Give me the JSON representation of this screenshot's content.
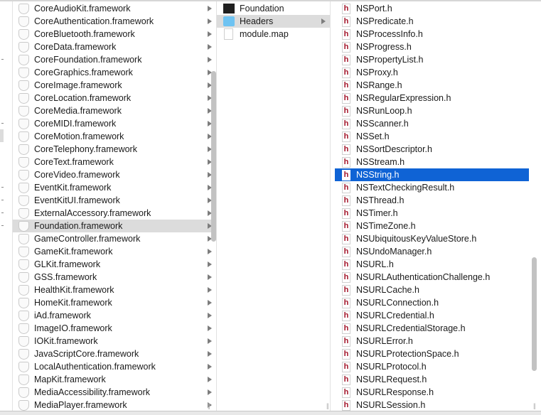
{
  "column1": {
    "items": [
      "CoreAudioKit.framework",
      "CoreAuthentication.framework",
      "CoreBluetooth.framework",
      "CoreData.framework",
      "CoreFoundation.framework",
      "CoreGraphics.framework",
      "CoreImage.framework",
      "CoreLocation.framework",
      "CoreMedia.framework",
      "CoreMIDI.framework",
      "CoreMotion.framework",
      "CoreTelephony.framework",
      "CoreText.framework",
      "CoreVideo.framework",
      "EventKit.framework",
      "EventKitUI.framework",
      "ExternalAccessory.framework",
      "Foundation.framework",
      "GameController.framework",
      "GameKit.framework",
      "GLKit.framework",
      "GSS.framework",
      "HealthKit.framework",
      "HomeKit.framework",
      "iAd.framework",
      "ImageIO.framework",
      "IOKit.framework",
      "JavaScriptCore.framework",
      "LocalAuthentication.framework",
      "MapKit.framework",
      "MediaAccessibility.framework",
      "MediaPlayer.framework"
    ],
    "selected": "Foundation.framework",
    "icon": "framework-shield-icon"
  },
  "column2": {
    "items": [
      {
        "label": "Foundation",
        "icon": "executable-icon"
      },
      {
        "label": "Headers",
        "icon": "folder-icon",
        "has_children": true
      },
      {
        "label": "module.map",
        "icon": "document-icon"
      }
    ],
    "selected": "Headers"
  },
  "column3": {
    "items": [
      "NSPort.h",
      "NSPredicate.h",
      "NSProcessInfo.h",
      "NSProgress.h",
      "NSPropertyList.h",
      "NSProxy.h",
      "NSRange.h",
      "NSRegularExpression.h",
      "NSRunLoop.h",
      "NSScanner.h",
      "NSSet.h",
      "NSSortDescriptor.h",
      "NSStream.h",
      "NSString.h",
      "NSTextCheckingResult.h",
      "NSThread.h",
      "NSTimer.h",
      "NSTimeZone.h",
      "NSUbiquitousKeyValueStore.h",
      "NSUndoManager.h",
      "NSURL.h",
      "NSURLAuthenticationChallenge.h",
      "NSURLCache.h",
      "NSURLConnection.h",
      "NSURLCredential.h",
      "NSURLCredentialStorage.h",
      "NSURLError.h",
      "NSURLProtectionSpace.h",
      "NSURLProtocol.h",
      "NSURLRequest.h",
      "NSURLResponse.h",
      "NSURLSession.h"
    ],
    "selected": "NSString.h",
    "icon_glyph": "h",
    "icon": "header-file-icon"
  },
  "colors": {
    "selection_blue": "#0f63d5",
    "selection_gray": "#dcdcdc",
    "header_icon": "#a3152a"
  }
}
